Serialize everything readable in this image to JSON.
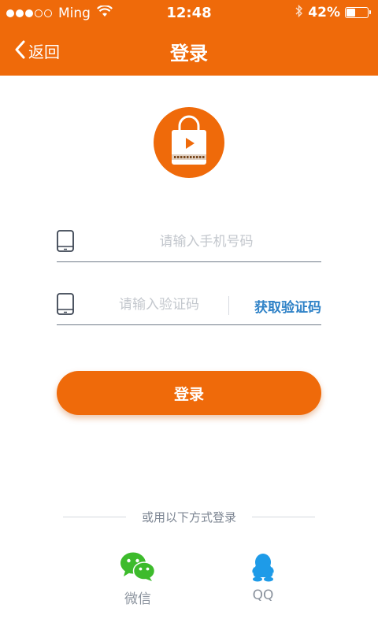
{
  "status_bar": {
    "carrier": "Ming",
    "time": "12:48",
    "battery_percent": "42%",
    "battery_level": 0.42,
    "signal_bars_filled": 3,
    "signal_bars_total": 5
  },
  "nav": {
    "back_label": "返回",
    "title": "登录"
  },
  "form": {
    "phone_placeholder": "请输入手机号码",
    "phone_value": "",
    "code_placeholder": "请输入验证码",
    "code_value": "",
    "get_code_label": "获取验证码",
    "submit_label": "登录"
  },
  "social": {
    "divider_text": "或用以下方式登录",
    "options": [
      {
        "label": "微信",
        "icon": "wechat-icon"
      },
      {
        "label": "QQ",
        "icon": "qq-icon"
      }
    ]
  },
  "colors": {
    "brand": "#ef6a0a",
    "link": "#2f82c7",
    "wechat": "#3dbb2c",
    "qq": "#1e9be8"
  }
}
